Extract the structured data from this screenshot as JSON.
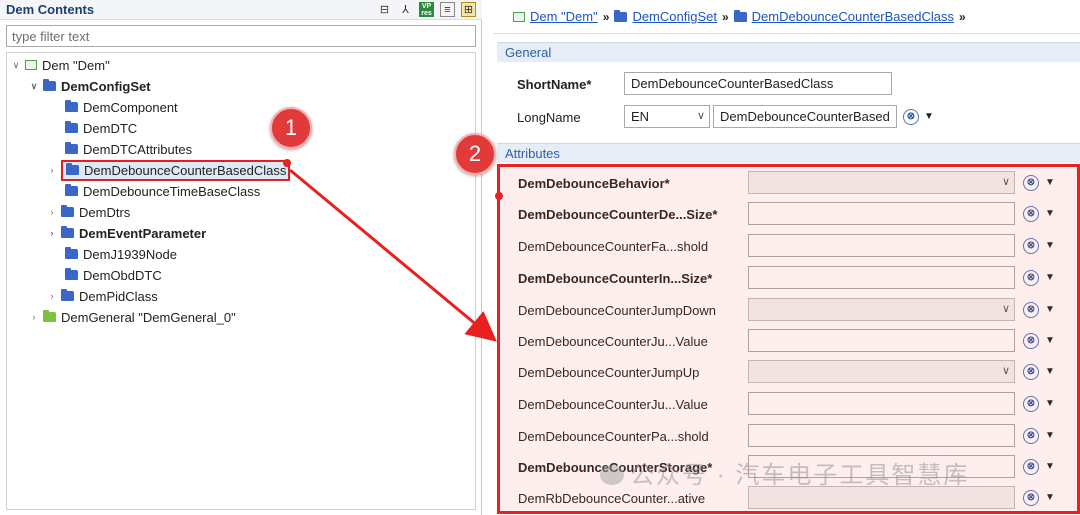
{
  "left_panel": {
    "title": "Dem Contents",
    "filter_placeholder": "type filter text",
    "tree": [
      {
        "label": "Dem \"Dem\""
      },
      {
        "label": "DemConfigSet"
      },
      {
        "label": "DemComponent"
      },
      {
        "label": "DemDTC"
      },
      {
        "label": "DemDTCAttributes"
      },
      {
        "label": "DemDebounceCounterBasedClass"
      },
      {
        "label": "DemDebounceTimeBaseClass"
      },
      {
        "label": "DemDtrs"
      },
      {
        "label": "DemEventParameter"
      },
      {
        "label": "DemJ1939Node"
      },
      {
        "label": "DemObdDTC"
      },
      {
        "label": "DemPidClass"
      },
      {
        "label": "DemGeneral \"DemGeneral_0\""
      }
    ]
  },
  "breadcrumb": {
    "items": [
      "Dem \"Dem\"",
      "DemConfigSet",
      "DemDebounceCounterBasedClass"
    ],
    "separator": "»"
  },
  "general": {
    "section_label": "General",
    "shortname_label": "ShortName*",
    "shortname_value": "DemDebounceCounterBasedClass",
    "longname_label": "LongName",
    "lang_value": "EN",
    "longname_value": "DemDebounceCounterBased"
  },
  "attributes": {
    "section_label": "Attributes",
    "rows": [
      {
        "label": "DemDebounceBehavior*"
      },
      {
        "label": "DemDebounceCounterDe...Size*"
      },
      {
        "label": "DemDebounceCounterFa...shold"
      },
      {
        "label": "DemDebounceCounterIn...Size*"
      },
      {
        "label": "DemDebounceCounterJumpDown"
      },
      {
        "label": "DemDebounceCounterJu...Value"
      },
      {
        "label": "DemDebounceCounterJumpUp"
      },
      {
        "label": "DemDebounceCounterJu...Value"
      },
      {
        "label": "DemDebounceCounterPa...shold"
      },
      {
        "label": "DemDebounceCounterStorage*"
      },
      {
        "label": "DemRbDebounceCounter...ative"
      }
    ]
  },
  "annotations": {
    "badge1": "1",
    "badge2": "2",
    "arrow_color": "#e82020",
    "box_color": "#e82020"
  },
  "watermark": "公众号 · 汽车电子工具智慧库",
  "colors": {
    "link": "#1b55c4",
    "section_text": "#2f5fa7",
    "section_bg": "#e6edf6",
    "folder": "#3a66c8",
    "folder_green": "#7cc142",
    "badge": "#e03a3a"
  }
}
